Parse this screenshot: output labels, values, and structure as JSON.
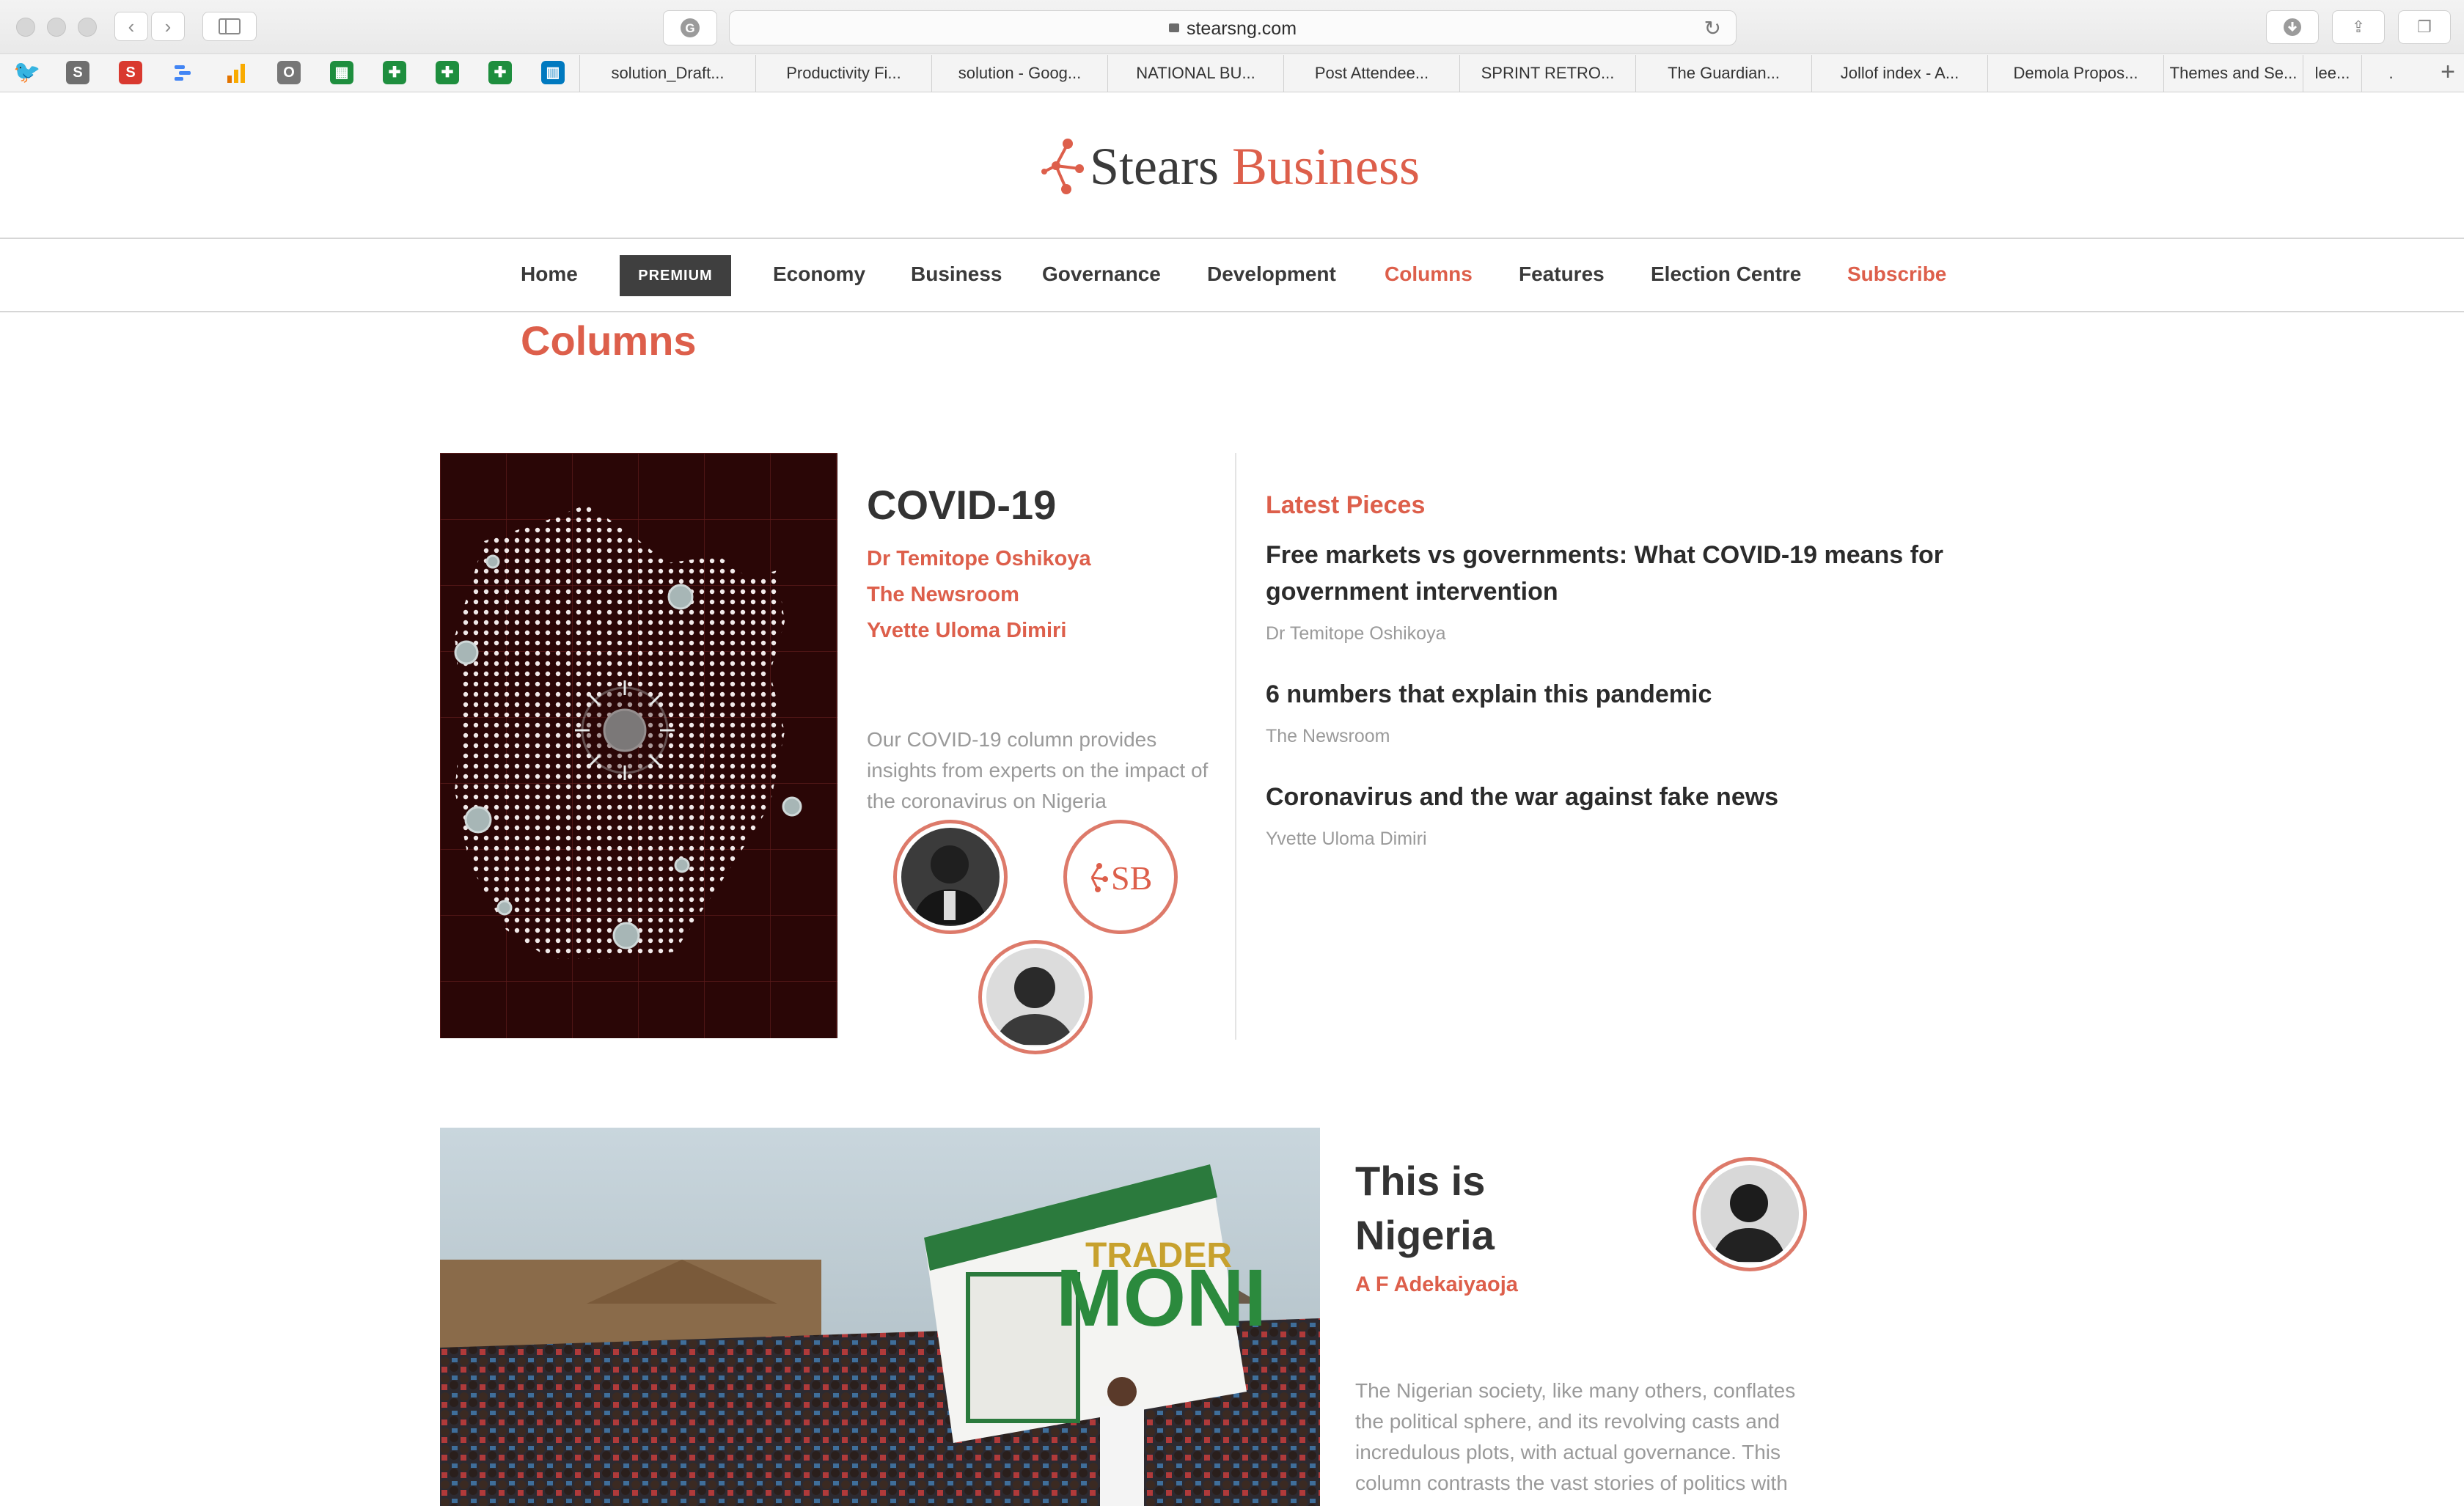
{
  "browser": {
    "url": "stearsng.com",
    "bookmarks": [
      "solution_Draft...",
      "Productivity Fi...",
      "solution - Goog...",
      "NATIONAL BU...",
      "Post Attendee...",
      "SPRINT RETRO...",
      "The Guardian...",
      "Jollof index - A...",
      "Demola Propos...",
      "Themes and Se...",
      "lee...",
      "."
    ]
  },
  "site": {
    "logo_part1": "Stears",
    "logo_part2": "Business",
    "colors": {
      "accent": "#dd5f4b",
      "text": "#2b2b2b",
      "muted": "#9a9a9a"
    }
  },
  "nav": {
    "home": "Home",
    "premium": "PREMIUM",
    "economy": "Economy",
    "business": "Business",
    "governance": "Governance",
    "development": "Development",
    "columns": "Columns",
    "features": "Features",
    "election": "Election Centre",
    "subscribe": "Subscribe"
  },
  "page": {
    "title": "Columns"
  },
  "covid": {
    "title": "COVID-19",
    "authors": [
      "Dr Temitope Oshikoya",
      "The Newsroom",
      "Yvette Uloma Dimiri"
    ],
    "description": "Our COVID-19 column provides insights from experts on the impact of the coronavirus on Nigeria",
    "sb_badge": "SB",
    "latest_heading": "Latest Pieces",
    "pieces": [
      {
        "title": "Free markets vs governments: What COVID-19 means for government intervention",
        "author": "Dr Temitope Oshikoya"
      },
      {
        "title": "6 numbers that explain this pandemic",
        "author": "The Newsroom"
      },
      {
        "title": "Coronavirus and the war against fake news",
        "author": "Yvette Uloma Dimiri"
      }
    ]
  },
  "nigeria": {
    "title_line1": "This is",
    "title_line2": "Nigeria",
    "author": "A F Adekaiyaoja",
    "description": "The Nigerian society, like many others, conflates the political sphere, and its revolving casts and incredulous plots, with actual governance. This column contrasts the vast stories of politics with",
    "banner_text1": "TRADER",
    "banner_text2": "MONI"
  }
}
